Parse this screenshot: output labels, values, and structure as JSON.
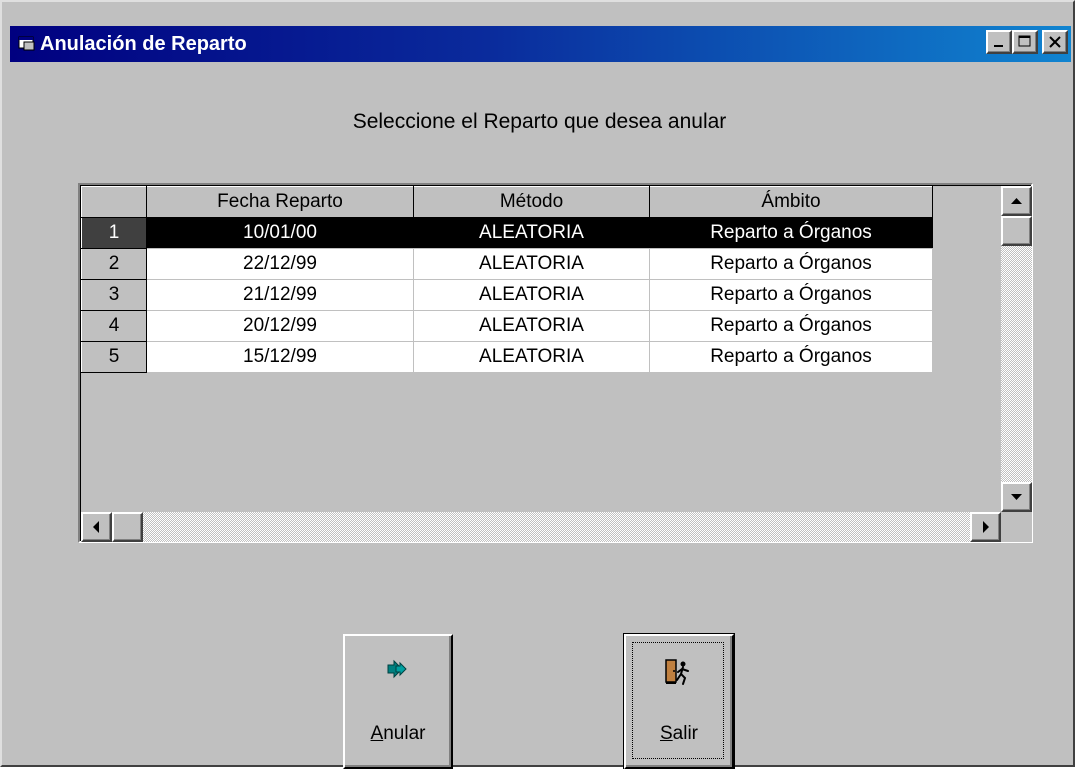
{
  "window": {
    "title": "Anulación de Reparto"
  },
  "instruction": "Seleccione el Reparto que desea anular",
  "grid": {
    "columns": [
      "Fecha Reparto",
      "Método",
      "Ámbito"
    ],
    "rows": [
      {
        "num": "1",
        "fecha": "10/01/00",
        "metodo": "ALEATORIA",
        "ambito": "Reparto a Órganos"
      },
      {
        "num": "2",
        "fecha": "22/12/99",
        "metodo": "ALEATORIA",
        "ambito": "Reparto a Órganos"
      },
      {
        "num": "3",
        "fecha": "21/12/99",
        "metodo": "ALEATORIA",
        "ambito": "Reparto a Órganos"
      },
      {
        "num": "4",
        "fecha": "20/12/99",
        "metodo": "ALEATORIA",
        "ambito": "Reparto a Órganos"
      },
      {
        "num": "5",
        "fecha": "15/12/99",
        "metodo": "ALEATORIA",
        "ambito": "Reparto a Órganos"
      }
    ],
    "selected_row": "1"
  },
  "buttons": {
    "anular": {
      "mnemonic": "A",
      "rest": "nular",
      "icon": "double-arrow-right-icon"
    },
    "salir": {
      "mnemonic": "S",
      "rest": "alir",
      "icon": "exit-door-icon"
    }
  },
  "colors": {
    "titlebar_start": "#000080",
    "titlebar_end": "#1084d0",
    "face": "#c0c0c0",
    "selection": "#000000",
    "anular_icon": "#008080"
  }
}
